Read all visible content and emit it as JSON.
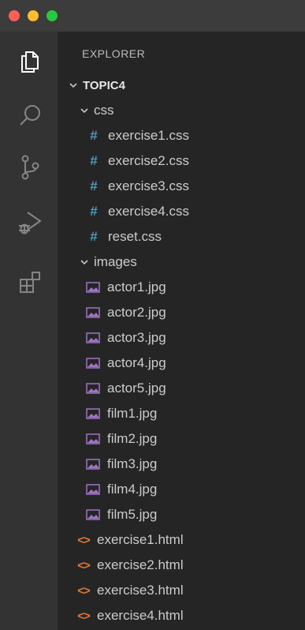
{
  "explorer": {
    "title": "EXPLORER",
    "project": "TOPIC4",
    "css_folder": {
      "name": "css",
      "files": [
        "exercise1.css",
        "exercise2.css",
        "exercise3.css",
        "exercise4.css",
        "reset.css"
      ]
    },
    "images_folder": {
      "name": "images",
      "files": [
        "actor1.jpg",
        "actor2.jpg",
        "actor3.jpg",
        "actor4.jpg",
        "actor5.jpg",
        "film1.jpg",
        "film2.jpg",
        "film3.jpg",
        "film4.jpg",
        "film5.jpg"
      ]
    },
    "root_files": [
      "exercise1.html",
      "exercise2.html",
      "exercise3.html",
      "exercise4.html"
    ]
  },
  "activity_bar": {
    "items": [
      "files-icon",
      "search-icon",
      "source-control-icon",
      "run-debug-icon",
      "extensions-icon"
    ]
  },
  "colors": {
    "css_icon": "#519aba",
    "html_icon": "#e37933",
    "image_icon": "#a074c4",
    "sidebar_bg": "#252526",
    "activity_bg": "#333333"
  }
}
